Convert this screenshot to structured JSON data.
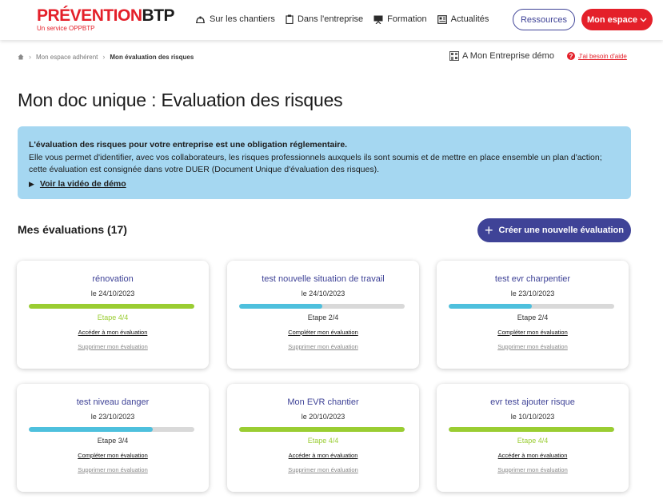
{
  "header": {
    "logo_main": "PRÉVENTION",
    "logo_btp": "BTP",
    "logo_sub": "Un service OPPBTP",
    "nav": [
      {
        "label": "Sur les chantiers",
        "icon": "hardhat-icon"
      },
      {
        "label": "Dans l'entreprise",
        "icon": "clipboard-icon"
      },
      {
        "label": "Formation",
        "icon": "presentation-board-icon"
      },
      {
        "label": "Actualités",
        "icon": "newspaper-icon"
      }
    ],
    "ressources_label": "Ressources",
    "espace_label": "Mon espace"
  },
  "breadcrumb": {
    "home_icon": "home-icon",
    "items": [
      "Mon espace adhérent",
      "Mon évaluation des risques"
    ]
  },
  "company": {
    "label": "A Mon Entreprise démo",
    "icon": "building-icon"
  },
  "help": {
    "label": "J'ai besoin d'aide",
    "icon": "help-icon"
  },
  "page_title": "Mon doc unique : Evaluation des risques",
  "info": {
    "strong": "L'évaluation des risques pour votre entreprise est une obligation réglementaire.",
    "text": "Elle vous permet d'identifier, avec vos collaborateurs, les risques professionnels auxquels ils sont soumis et de mettre en place ensemble un plan d'action; cette évaluation est consignée dans votre DUER (Document Unique d'évaluation des risques).",
    "video_label": "Voir la vidéo de démo"
  },
  "evaluations": {
    "title": "Mes évaluations (17)",
    "create_label": "Créer une nouvelle évaluation",
    "cards": [
      {
        "title": "rénovation",
        "date": "le 24/10/2023",
        "step": "Etape 4/4",
        "progress": 1.0,
        "action": "Accéder à mon évaluation",
        "delete": "Supprimer mon évaluation"
      },
      {
        "title": "test nouvelle situation de travail",
        "date": "le 24/10/2023",
        "step": "Etape 2/4",
        "progress": 0.5,
        "action": "Compléter mon évaluation",
        "delete": "Supprimer mon évaluation"
      },
      {
        "title": "test evr charpentier",
        "date": "le 23/10/2023",
        "step": "Etape 2/4",
        "progress": 0.5,
        "action": "Compléter mon évaluation",
        "delete": "Supprimer mon évaluation"
      },
      {
        "title": "test niveau danger",
        "date": "le 23/10/2023",
        "step": "Etape 3/4",
        "progress": 0.75,
        "action": "Compléter mon évaluation",
        "delete": "Supprimer mon évaluation"
      },
      {
        "title": "Mon EVR chantier",
        "date": "le 20/10/2023",
        "step": "Etape 4/4",
        "progress": 1.0,
        "action": "Accéder à mon évaluation",
        "delete": "Supprimer mon évaluation"
      },
      {
        "title": "evr test ajouter risque",
        "date": "le 10/10/2023",
        "step": "Etape 4/4",
        "progress": 1.0,
        "action": "Accéder à mon évaluation",
        "delete": "Supprimer mon évaluation"
      }
    ]
  },
  "colors": {
    "brand_red": "#e4202a",
    "brand_blue": "#3f4397",
    "info_bg": "#a5d7f1",
    "progress_done": "#9acd32",
    "progress_partial": "#4ec0dd",
    "progress_track": "#d9d9d9"
  }
}
